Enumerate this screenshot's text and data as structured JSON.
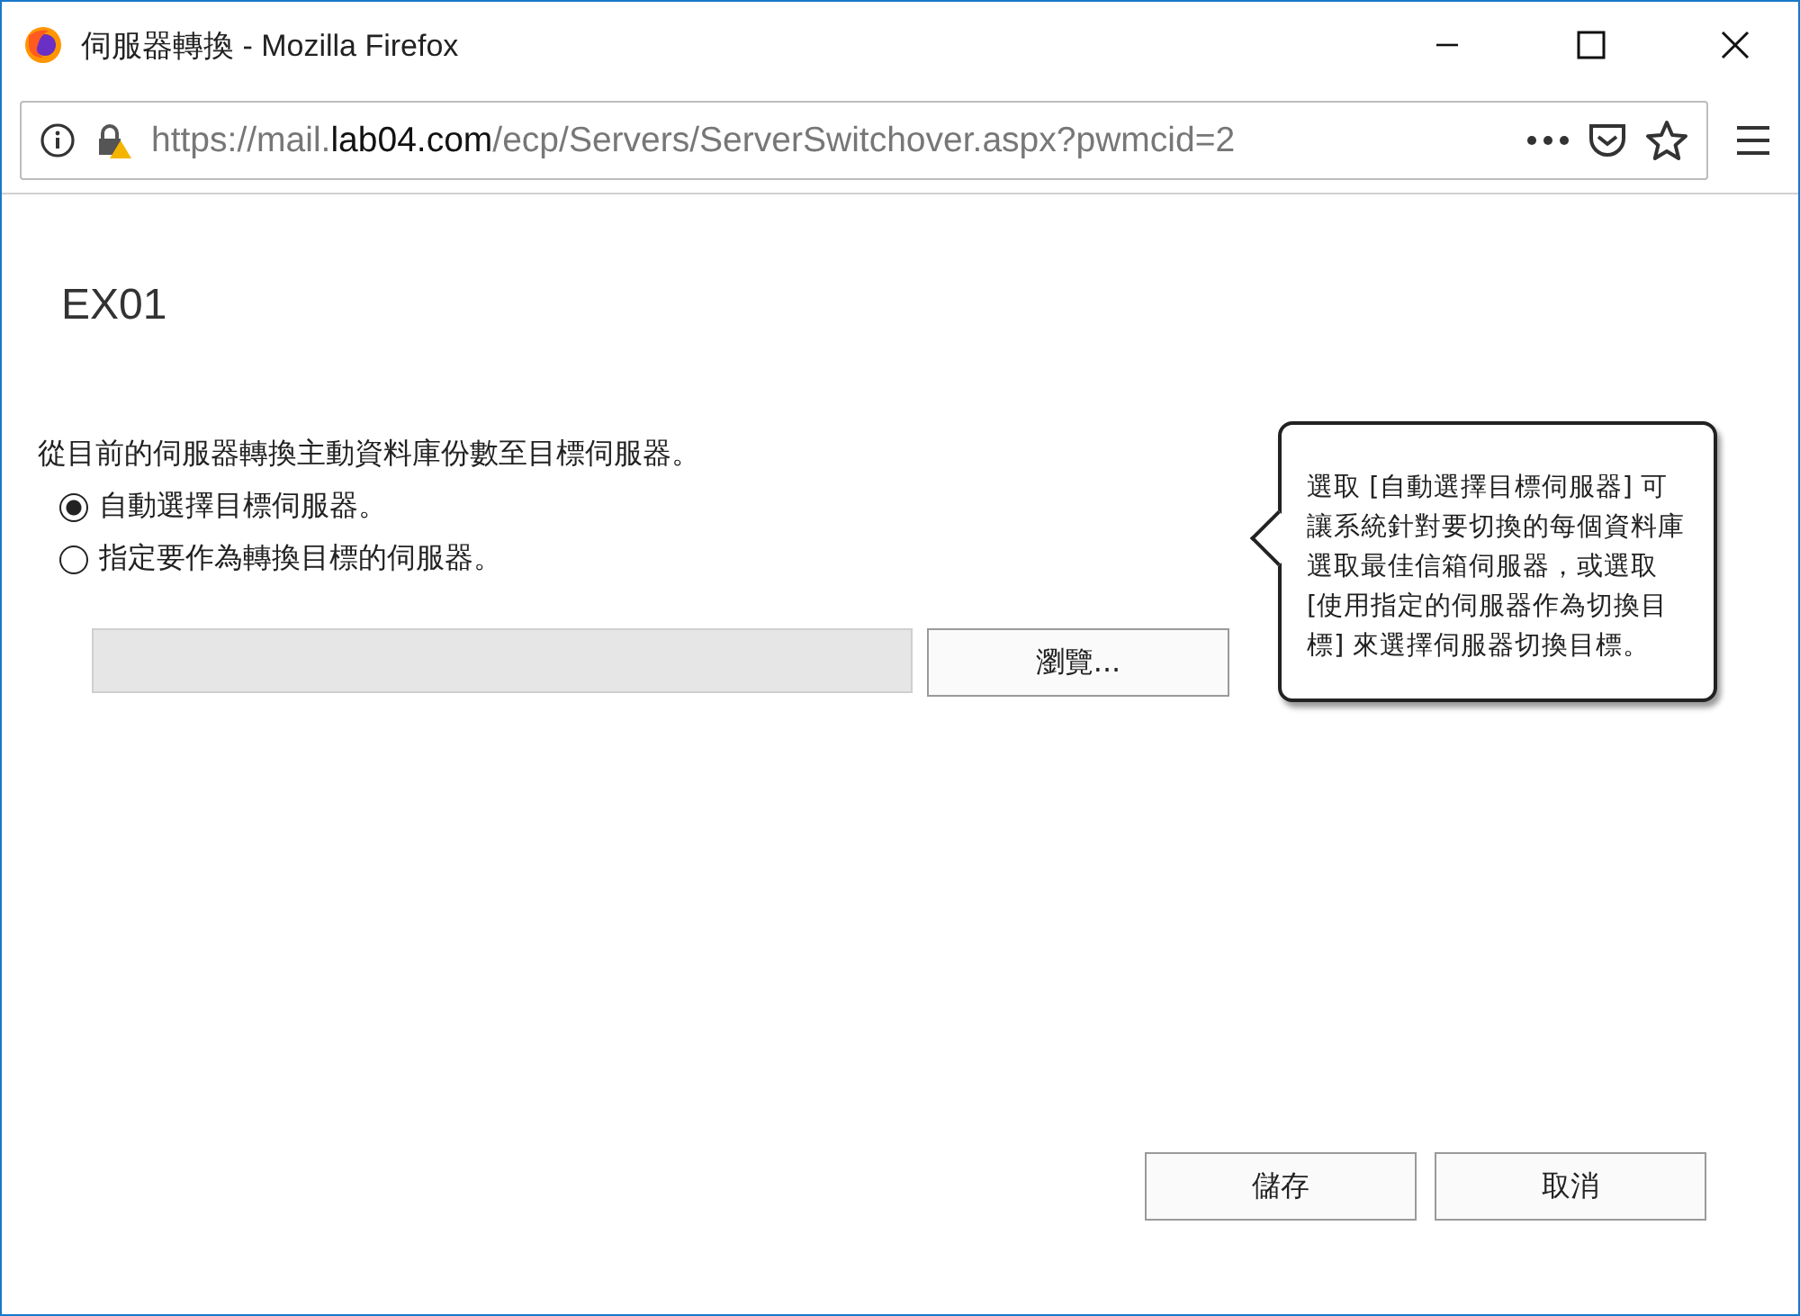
{
  "window": {
    "title": "伺服器轉換 - Mozilla Firefox"
  },
  "address_bar": {
    "url": "https://mail.**lab04.com**/ecp/Servers/ServerSwitchover.aspx?pwmcid=2"
  },
  "page": {
    "heading": "EX01",
    "description": "從目前的伺服器轉換主動資料庫份數至目標伺服器。",
    "options": [
      {
        "label": "自動選擇目標伺服器。",
        "selected": true
      },
      {
        "label": "指定要作為轉換目標的伺服器。",
        "selected": false
      }
    ],
    "server_field": {
      "disabled": true
    },
    "browse_button": "瀏覽...",
    "tooltip": "選取 [自動選擇目標伺服器] 可讓系統針對要切換的每個資料庫選取最佳信箱伺服器，或選取 [使用指定的伺服器作為切換目標] 來選擇伺服器切換目標。",
    "buttons": [
      "儲存",
      "取消"
    ]
  }
}
